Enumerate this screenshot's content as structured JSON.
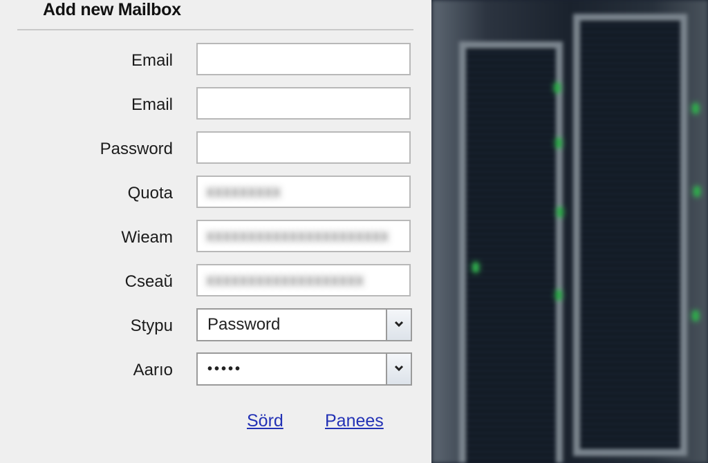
{
  "form": {
    "title": "Add new Mailbox",
    "fields": [
      {
        "label": "Email",
        "value": ""
      },
      {
        "label": "Email",
        "value": ""
      },
      {
        "label": "Password",
        "value": ""
      },
      {
        "label": "Quota",
        "value": "xxxxxxxxx"
      },
      {
        "label": "Wieam",
        "value": "xxxxxxxxxxxxxxxxxxxxxx"
      },
      {
        "label": "Cseaŭ",
        "value": "xxxxxxxxxxxxxxxxxxx"
      }
    ],
    "selects": [
      {
        "label": "Stypu",
        "value": "Password"
      },
      {
        "label": "Aarıo",
        "value": "•••••"
      }
    ],
    "links": {
      "send": "Sörd",
      "cancel": "Panees"
    }
  },
  "colors": {
    "panel_bg": "#efefef",
    "link": "#2231b5",
    "rack_light": "#2ea84a"
  },
  "icons": {
    "select_arrow": "chevron-down-icon"
  }
}
